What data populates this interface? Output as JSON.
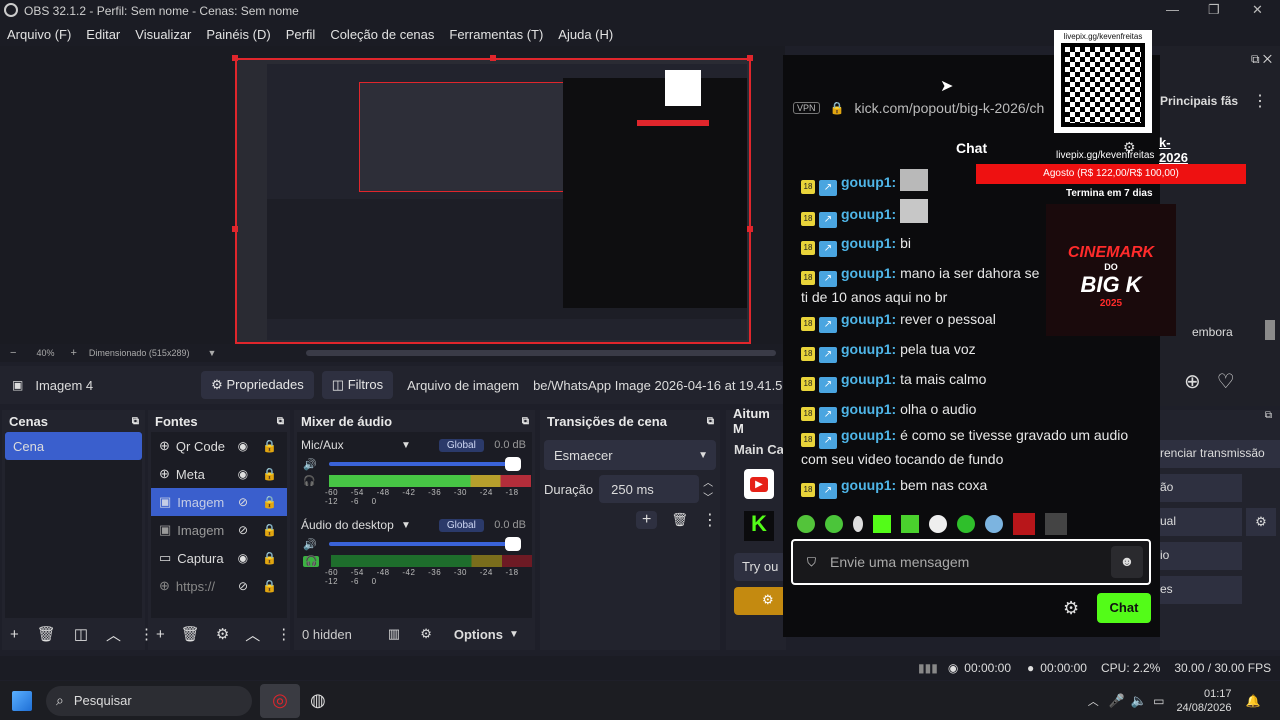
{
  "window": {
    "title": "OBS 32.1.2 - Perfil: Sem nome - Cenas: Sem nome"
  },
  "menu": [
    "Arquivo (F)",
    "Editar",
    "Visualizar",
    "Painéis (D)",
    "Perfil",
    "Coleção de cenas",
    "Ferramentas (T)",
    "Ajuda (H)"
  ],
  "zoom": {
    "percent": "40%",
    "scale": "Dimensionado (515x289)"
  },
  "source_toolbar": {
    "source_name": "Imagem 4",
    "properties": "Propriedades",
    "filters": "Filtros",
    "file_label": "Arquivo de imagem",
    "file_path": "be/WhatsApp Image 2026-04-16 at 19.41.57.j"
  },
  "scenes": {
    "title": "Cenas",
    "items": [
      "Cena"
    ]
  },
  "sources": {
    "title": "Fontes",
    "items": [
      "Qr Code",
      "Meta",
      "Imagem",
      "Imagem",
      "Captura",
      "https://"
    ]
  },
  "mixer": {
    "title": "Mixer de áudio",
    "channels": [
      {
        "name": "Mic/Aux",
        "tag": "Global",
        "db": "0.0 dB"
      },
      {
        "name": "Áudio do desktop",
        "tag": "Global",
        "db": "0.0 dB"
      }
    ],
    "ticks": "-60 -54 -48 -42 -36 -30 -24 -18 -12 -6 0",
    "hidden": "0 hidden",
    "options": "Options"
  },
  "transitions": {
    "title": "Transições de cena",
    "selected": "Esmaecer",
    "duration_label": "Duração",
    "duration_value": "250 ms"
  },
  "aitum": {
    "title": "Aitum M",
    "main": "Main Ca",
    "tryout": "Try ou"
  },
  "controls": {
    "items": [
      "renciar transmissão",
      "ão",
      "ual",
      "io",
      "es"
    ]
  },
  "chat": {
    "vpn": "VPN",
    "url": "kick.com/popout/big-k-2026/ch",
    "title": "Chat",
    "principal": "Principais fãs",
    "channel_link": "k-2026",
    "side_text": "embora",
    "messages": [
      {
        "user": "gouup1:",
        "text": ""
      },
      {
        "user": "gouup1:",
        "text": ""
      },
      {
        "user": "gouup1:",
        "text": "bi"
      },
      {
        "user": "gouup1:",
        "text": "mano ia ser dahora se ti de 10 anos aqui no br"
      },
      {
        "user": "gouup1:",
        "text": "rever o pessoal"
      },
      {
        "user": "gouup1:",
        "text": "pela tua voz"
      },
      {
        "user": "gouup1:",
        "text": "ta mais calmo"
      },
      {
        "user": "gouup1:",
        "text": "olha o audio"
      },
      {
        "user": "gouup1:",
        "text": "é como se tivesse gravado um audio com seu video tocando de fundo"
      },
      {
        "user": "gouup1:",
        "text": "bem nas coxa"
      }
    ],
    "badge": "18",
    "input_placeholder": "Envie uma mensagem",
    "send": "Chat"
  },
  "overlay": {
    "qr_label_top": "livepix.gg/kevenfreitas",
    "qr_label_bottom": "livepix.gg/kevenfreitas",
    "goal": "Agosto (R$ 122,00/R$ 100,00)",
    "goal_note": "Termina em 7 dias",
    "logo_text1": "CINEMARK",
    "logo_text2": "DO",
    "logo_text3": "BIG K",
    "logo_text4": "2025"
  },
  "status": {
    "rec_time": "00:00:00",
    "stream_time": "00:00:00",
    "cpu": "CPU: 2.2%",
    "fps": "30.00 / 30.00 FPS"
  },
  "taskbar": {
    "search": "Pesquisar",
    "time": "01:17",
    "date": "24/08/2026"
  },
  "colors": {
    "accent": "#3a5fcd",
    "red": "#e0262c",
    "kick_green": "#53fc18"
  }
}
